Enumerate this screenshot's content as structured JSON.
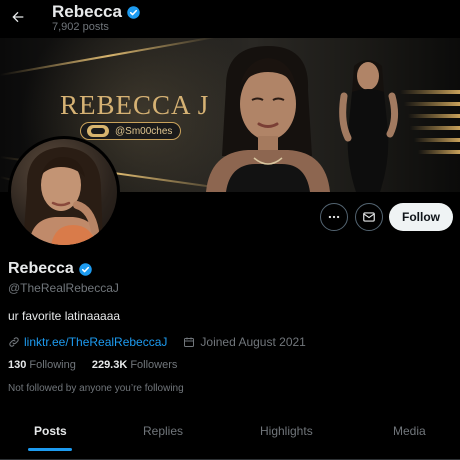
{
  "header": {
    "name": "Rebecca",
    "post_count": "7,902 posts",
    "back_icon": "arrow-left-icon",
    "verified_icon": "verified-badge-icon"
  },
  "banner": {
    "title": "REBECCA J",
    "handle_tag": "@Sm00ches"
  },
  "actions": {
    "more_icon": "more-icon",
    "message_icon": "envelope-icon",
    "follow_label": "Follow"
  },
  "profile": {
    "name": "Rebecca",
    "handle": "@TheRealRebeccaJ",
    "bio": "ur favorite latinaaaaa",
    "link_text": "linktr.ee/TheRealRebeccaJ",
    "joined": "Joined August 2021",
    "following_count": "130",
    "following_label": "Following",
    "followers_count": "229.3K",
    "followers_label": "Followers",
    "follow_note": "Not followed by anyone you’re following"
  },
  "tabs": [
    {
      "label": "Posts",
      "active": true
    },
    {
      "label": "Replies",
      "active": false
    },
    {
      "label": "Highlights",
      "active": false
    },
    {
      "label": "Media",
      "active": false
    }
  ],
  "colors": {
    "accent": "#1d9bf0",
    "gold": "#d6b274",
    "muted": "#71767b"
  }
}
